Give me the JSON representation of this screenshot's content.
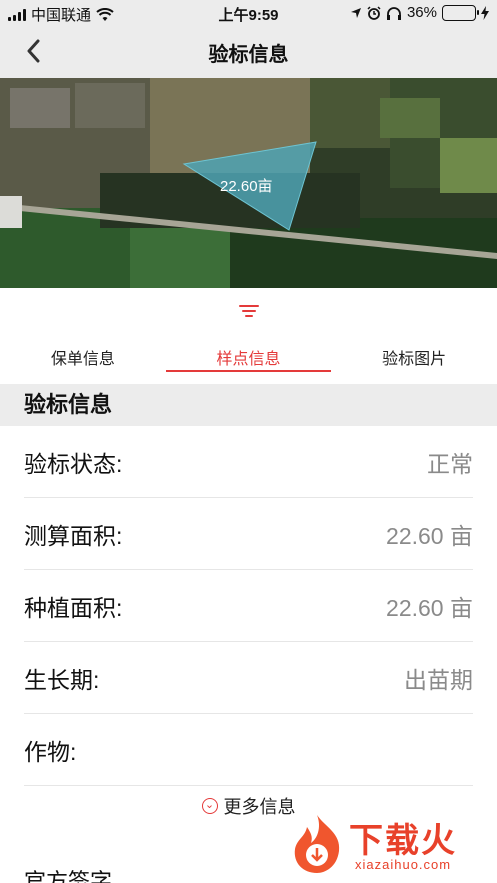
{
  "status_bar": {
    "carrier": "中国联通",
    "time": "上午9:59",
    "battery_percent": "36%",
    "battery_level": 0.36
  },
  "nav": {
    "title": "验标信息"
  },
  "map": {
    "plot_area_label": "22.60亩",
    "polygon_color": "#4fa3b3"
  },
  "tabs": [
    {
      "label": "保单信息",
      "active": false
    },
    {
      "label": "样点信息",
      "active": true
    },
    {
      "label": "验标图片",
      "active": false
    }
  ],
  "section": {
    "title": "验标信息"
  },
  "rows": [
    {
      "label": "验标状态:",
      "value": "正常"
    },
    {
      "label": "测算面积:",
      "value": "22.60 亩"
    },
    {
      "label": "种植面积:",
      "value": "22.60 亩"
    },
    {
      "label": "生长期:",
      "value": "出苗期"
    },
    {
      "label": "作物:",
      "value": ""
    }
  ],
  "more_link": "更多信息",
  "next_section_label": "官方签字",
  "watermark": {
    "brand": "下载火",
    "url": "xiazaihuo.com"
  },
  "colors": {
    "accent": "#e43a3a",
    "header_bg": "#ececec"
  }
}
